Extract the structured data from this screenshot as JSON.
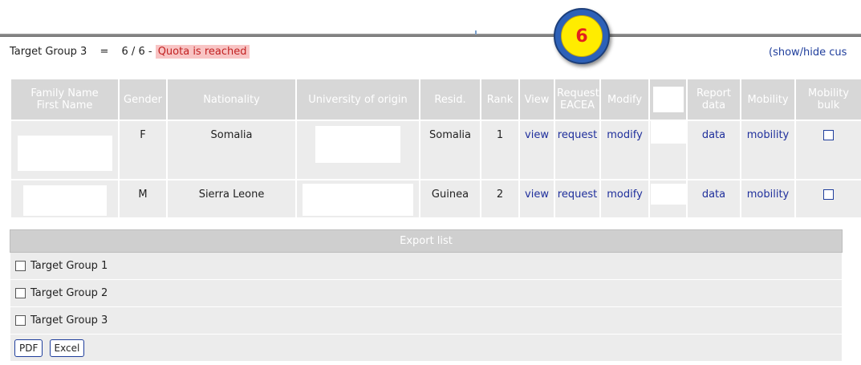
{
  "badge": {
    "number": "6"
  },
  "target_group": {
    "label": "Target Group 3",
    "equals": "=",
    "count": "6 / 6",
    "separator": "-",
    "quota_text": "Quota is reached"
  },
  "show_hide": "(show/hide cus",
  "table": {
    "headers": [
      "Family Name\nFirst Name",
      "Gender",
      "Nationality",
      "University of origin",
      "Resid.",
      "Rank",
      "View",
      "Request\nEACEA",
      "Modify",
      "",
      "Report\ndata",
      "Mobility",
      "Mobility\nbulk"
    ],
    "rows": [
      {
        "gender": "F",
        "nationality": "Somalia",
        "resid": "Somalia",
        "rank": "1",
        "view": "view",
        "request": "request",
        "modify": "modify",
        "report": "data",
        "mobility": "mobility"
      },
      {
        "gender": "M",
        "nationality": "Sierra Leone",
        "resid": "Guinea",
        "rank": "2",
        "view": "view",
        "request": "request",
        "modify": "modify",
        "report": "data",
        "mobility": "mobility"
      }
    ]
  },
  "export": {
    "title": "Export list",
    "options": [
      "Target Group 1",
      "Target Group 2",
      "Target Group 3"
    ],
    "buttons": {
      "pdf": "PDF",
      "excel": "Excel"
    }
  }
}
